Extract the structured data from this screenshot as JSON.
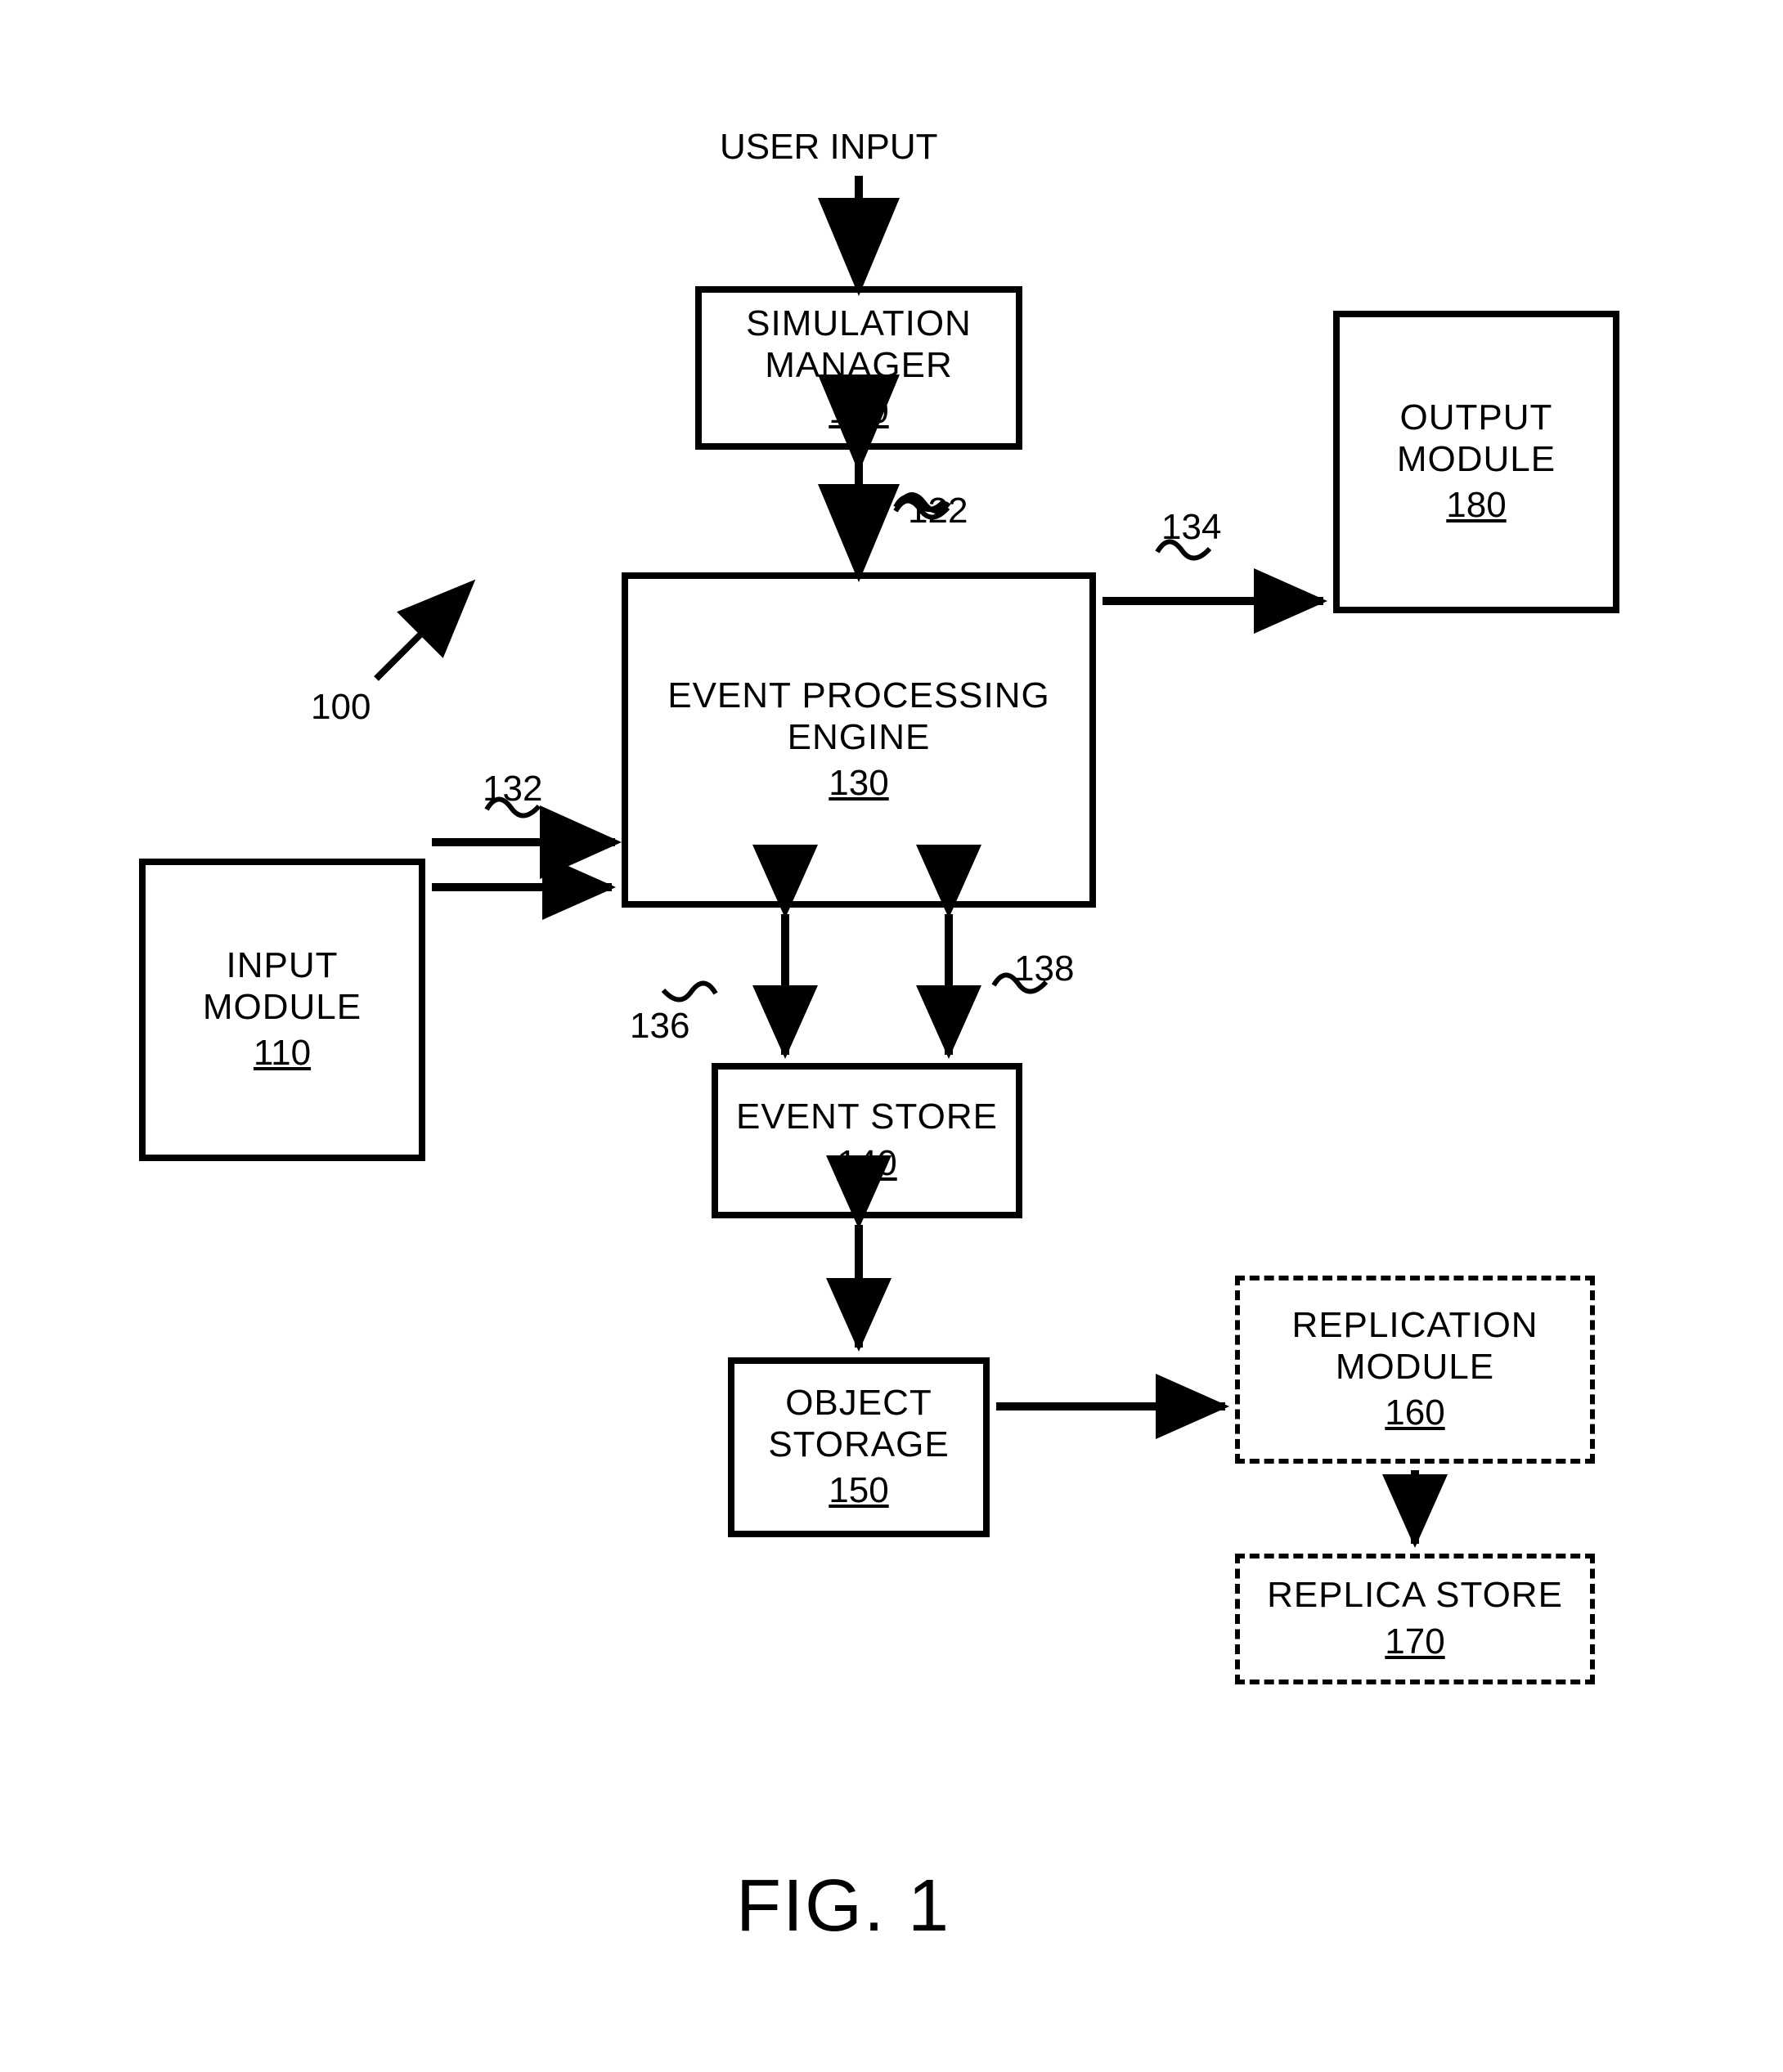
{
  "figure_label": "FIG. 1",
  "overall_ref": "100",
  "user_input_label": "USER INPUT",
  "boxes": {
    "input_module": {
      "title": "INPUT MODULE",
      "ref": "110"
    },
    "sim_manager": {
      "title": "SIMULATION\nMANAGER",
      "ref": "120"
    },
    "epe": {
      "title": "EVENT PROCESSING ENGINE",
      "ref": "130"
    },
    "event_store": {
      "title": "EVENT STORE",
      "ref": "140"
    },
    "object_storage": {
      "title": "OBJECT\nSTORAGE",
      "ref": "150"
    },
    "replication": {
      "title": "REPLICATION\nMODULE",
      "ref": "160"
    },
    "replica_store": {
      "title": "REPLICA STORE",
      "ref": "170"
    },
    "output_module": {
      "title": "OUTPUT\nMODULE",
      "ref": "180"
    }
  },
  "conn_refs": {
    "sim_to_epe": "122",
    "input_to_epe": "132",
    "epe_to_output": "134",
    "epe_store_left": "136",
    "epe_store_right": "138"
  }
}
